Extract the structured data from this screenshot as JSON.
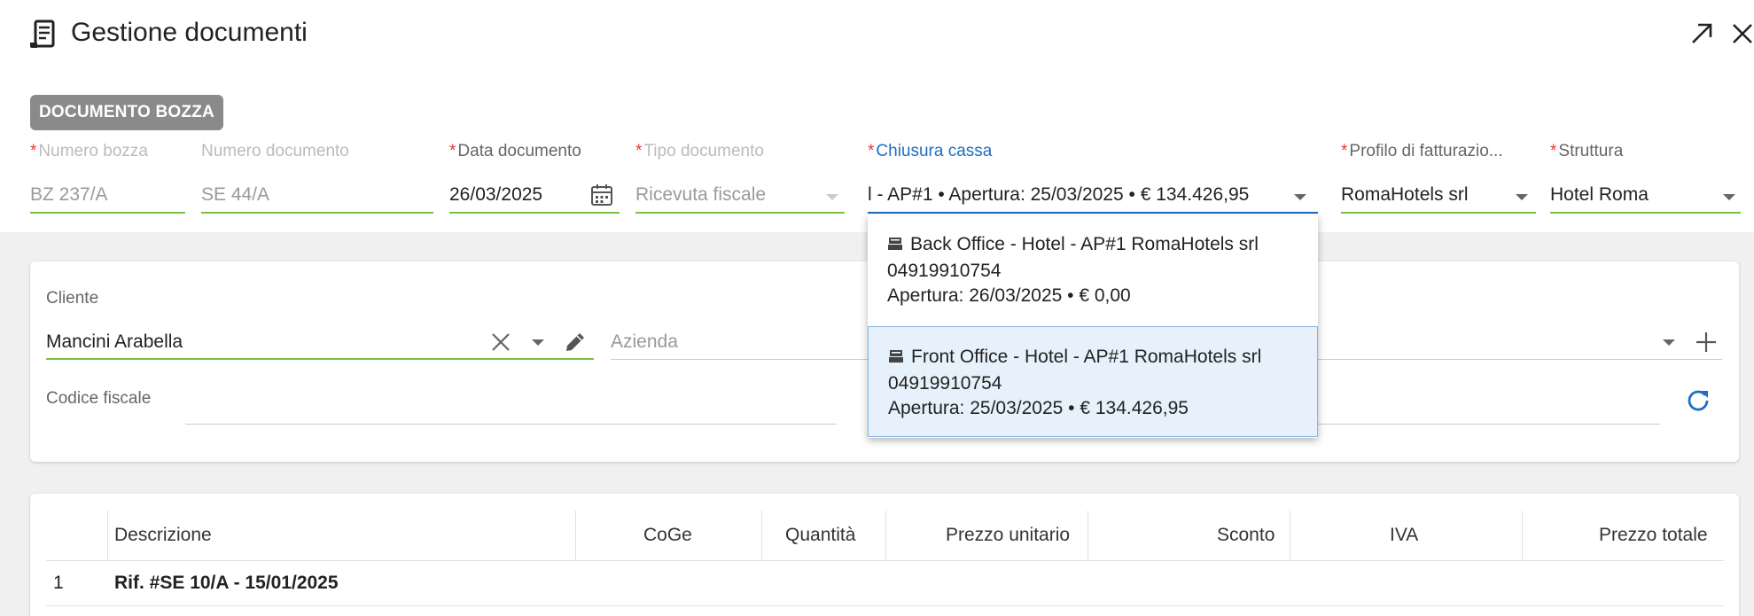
{
  "window": {
    "title": "Gestione documenti",
    "icon": "receipt-icon",
    "expand_icon": "expand-icon",
    "close_icon": "close-icon"
  },
  "badge": "DOCUMENTO BOZZA",
  "fields": {
    "numero_bozza": {
      "label": "Numero bozza",
      "value": "BZ 237/A",
      "required": true
    },
    "numero_documento": {
      "label": "Numero documento",
      "value": "SE 44/A",
      "required": false
    },
    "data_documento": {
      "label": "Data documento",
      "value": "26/03/2025",
      "required": true
    },
    "tipo_documento": {
      "label": "Tipo documento",
      "value": "Ricevuta fiscale",
      "required": true
    },
    "chiusura_cassa": {
      "label": "Chiusura cassa",
      "value": "l - AP#1 • Apertura: 25/03/2025 • € 134.426,95",
      "required": true
    },
    "profilo_fatturazione": {
      "label": "Profilo di fatturazio...",
      "value": "RomaHotels srl",
      "required": true
    },
    "struttura": {
      "label": "Struttura",
      "value": "Hotel Roma",
      "required": true
    }
  },
  "chiusura_options": [
    {
      "line1": "Back Office - Hotel - AP#1 RomaHotels srl",
      "line2": "04919910754",
      "line3": "Apertura: 26/03/2025 • € 0,00"
    },
    {
      "line1": "Front Office - Hotel - AP#1 RomaHotels srl",
      "line2": "04919910754",
      "line3": "Apertura: 25/03/2025 • € 134.426,95"
    }
  ],
  "cliente": {
    "label": "Cliente",
    "value": "Mancini Arabella",
    "azienda_placeholder": "Azienda",
    "codice_fiscale_label": "Codice fiscale"
  },
  "table": {
    "headers": [
      "Descrizione",
      "CoGe",
      "Quantità",
      "Prezzo unitario",
      "Sconto",
      "IVA",
      "Prezzo totale"
    ],
    "rows": [
      {
        "num": "1",
        "descrizione": "Rif. #SE 10/A - 15/01/2025"
      }
    ]
  },
  "colors": {
    "accent_green": "#7ac142",
    "focus_blue": "#1e6fc1",
    "required_red": "#e53935",
    "selected_bg": "#e6f1fb"
  }
}
